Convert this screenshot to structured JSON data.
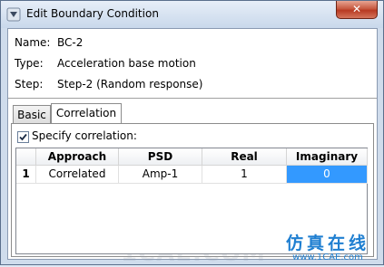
{
  "window": {
    "title": "Edit Boundary Condition",
    "close_label": "✕"
  },
  "fields": {
    "name_label": "Name:",
    "name_value": "BC-2",
    "type_label": "Type:",
    "type_value": "Acceleration base motion",
    "step_label": "Step:",
    "step_value": "Step-2 (Random response)"
  },
  "tabs": [
    {
      "label": "Basic",
      "active": false
    },
    {
      "label": "Correlation",
      "active": true
    }
  ],
  "correlation": {
    "checkbox_label": "Specify correlation:",
    "checked": true,
    "columns": [
      "Approach",
      "PSD",
      "Real",
      "Imaginary"
    ],
    "rows": [
      {
        "index": "1",
        "approach": "Correlated",
        "psd": "Amp-1",
        "real": "1",
        "imaginary": "0"
      }
    ]
  },
  "watermark": {
    "background": "1CAE.COM",
    "cn": "仿真在线",
    "url": "www.1CAE.com"
  },
  "colors": {
    "selected_cell": "#3399ff",
    "watermark_blue": "#1f7fd1"
  }
}
